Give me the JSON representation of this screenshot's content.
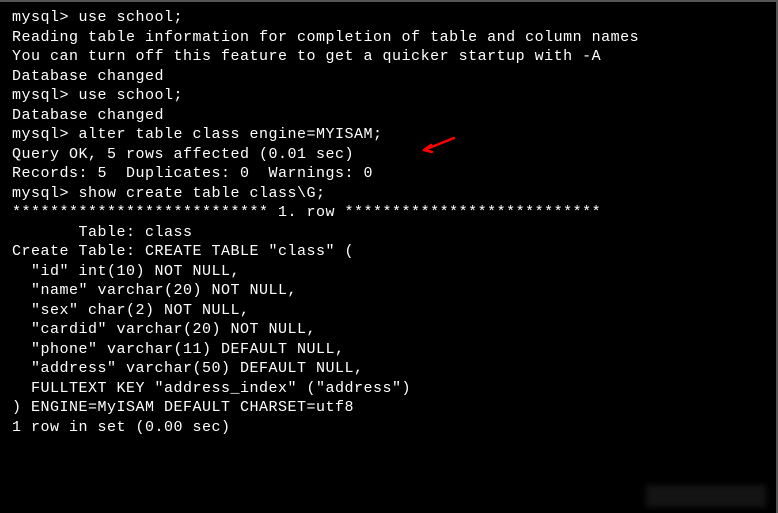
{
  "lines": {
    "l0": "mysql> use school;",
    "l1": "Reading table information for completion of table and column names",
    "l2": "You can turn off this feature to get a quicker startup with -A",
    "l3": "",
    "l4": "Database changed",
    "l5": "mysql> use school;",
    "l6": "Database changed",
    "l7": "mysql> alter table class engine=MYISAM;",
    "l8": "Query OK, 5 rows affected (0.01 sec)",
    "l9": "Records: 5  Duplicates: 0  Warnings: 0",
    "l10": "",
    "l11": "mysql> show create table class\\G;",
    "l12": "*************************** 1. row ***************************",
    "l13": "       Table: class",
    "l14": "Create Table: CREATE TABLE \"class\" (",
    "l15": "  \"id\" int(10) NOT NULL,",
    "l16": "  \"name\" varchar(20) NOT NULL,",
    "l17": "  \"sex\" char(2) NOT NULL,",
    "l18": "  \"cardid\" varchar(20) NOT NULL,",
    "l19": "  \"phone\" varchar(11) DEFAULT NULL,",
    "l20": "  \"address\" varchar(50) DEFAULT NULL,",
    "l21": "  FULLTEXT KEY \"address_index\" (\"address\")",
    "l22": ") ENGINE=MyISAM DEFAULT CHARSET=utf8",
    "l23": "1 row in set (0.00 sec)"
  },
  "arrow": {
    "color": "#ff0000"
  }
}
